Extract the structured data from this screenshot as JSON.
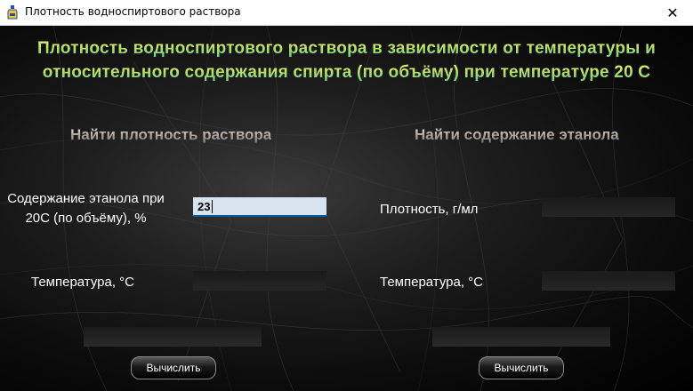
{
  "window": {
    "title": "Плотность водноспиртового раствора",
    "close_glyph": "✕",
    "icon": "bottle-app-icon"
  },
  "heading": {
    "line1": "Плотность водноспиртового раствора в зависимости от температуры и",
    "line2": "относительного содержания спирта (по объёму) при температуре 20 С"
  },
  "left": {
    "title": "Найти плотность раствора",
    "ethanol_label_line1": "Содержание этанола при",
    "ethanol_label_line2": "20С (по объёму), %",
    "ethanol_value": "23",
    "temperature_label": "Температура, °С",
    "temperature_value": "",
    "result_value": "",
    "button_label": "Вычислить"
  },
  "right": {
    "title": "Найти содержание этанола",
    "density_label": "Плотность, г/мл",
    "density_value": "",
    "temperature_label": "Температура, °С",
    "temperature_value": "",
    "result_value": "",
    "button_label": "Вычислить"
  },
  "colors": {
    "heading_top": "#f3f06a",
    "heading_bottom": "#5fd08a",
    "active_input_bg": "#d7e3ee",
    "active_input_border": "#0a5aa3"
  }
}
